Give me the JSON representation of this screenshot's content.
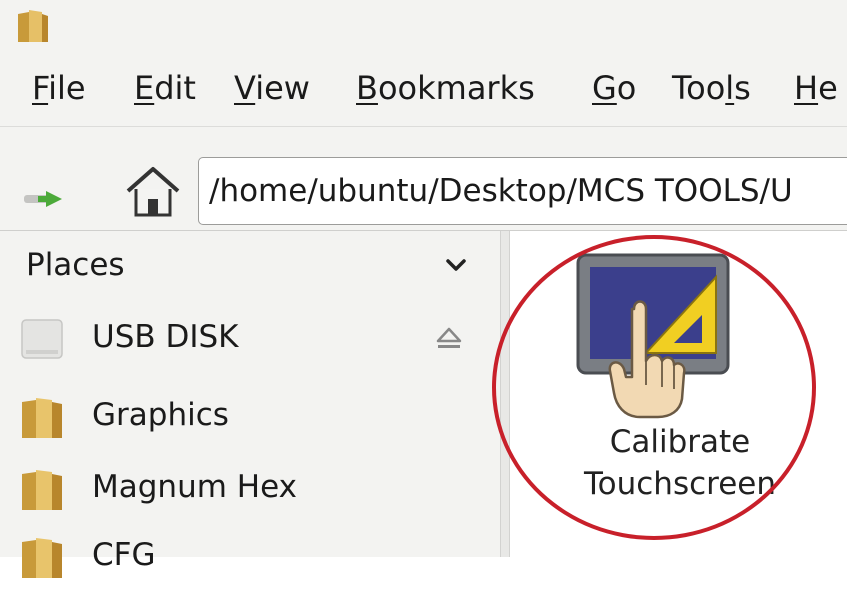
{
  "menubar": {
    "items": [
      {
        "label": "File",
        "mnemonic": "F",
        "rest": "ile"
      },
      {
        "label": "Edit",
        "mnemonic": "E",
        "rest": "dit"
      },
      {
        "label": "View",
        "mnemonic": "V",
        "rest": "iew"
      },
      {
        "label": "Bookmarks",
        "mnemonic": "B",
        "rest": "ookmarks"
      },
      {
        "label": "Go",
        "mnemonic": "G",
        "rest": "o"
      },
      {
        "label": "Tools",
        "pre": "Too",
        "mnemonic": "l",
        "rest": "s"
      },
      {
        "label": "He",
        "pre": "",
        "mnemonic": "H",
        "rest": "e"
      }
    ]
  },
  "toolbar": {
    "address_value": "/home/ubuntu/Desktop/MCS TOOLS/U"
  },
  "sidebar": {
    "header": "Places",
    "items": [
      {
        "label": "USB DISK",
        "icon": "drive-icon"
      },
      {
        "label": "Graphics",
        "icon": "folder-icon"
      },
      {
        "label": "Magnum Hex",
        "icon": "folder-icon"
      },
      {
        "label": "CFG",
        "icon": "folder-icon"
      }
    ]
  },
  "main": {
    "file": {
      "line1": "Calibrate",
      "line2": "Touchscreen",
      "icon": "touchscreen-calibrate-icon"
    }
  },
  "colors": {
    "highlight_ring": "#c8202a",
    "chrome_bg": "#f3f3f1"
  }
}
